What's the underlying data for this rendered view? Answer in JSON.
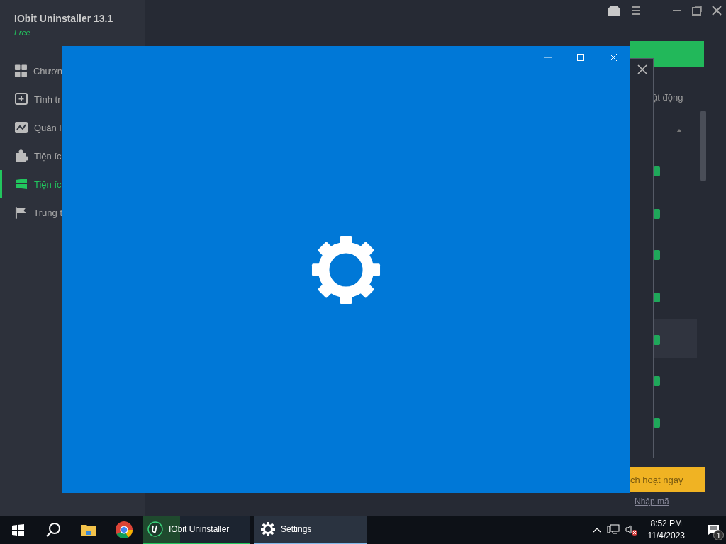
{
  "background_app": {
    "title": "IObit Uninstaller 13.1",
    "edition": "Free",
    "sidebar": [
      {
        "label": "Chươn",
        "selected": false
      },
      {
        "label": "Tình tr",
        "selected": false
      },
      {
        "label": "Quản l",
        "selected": false
      },
      {
        "label": "Tiện íc",
        "selected": false
      },
      {
        "label": "Tiện íc",
        "selected": true
      },
      {
        "label": "Trung t",
        "selected": false
      }
    ],
    "section_label": "ật động",
    "activate_button": "ch hoạt ngay",
    "link": "Nhập mã"
  },
  "taskbar": {
    "apps": [
      {
        "label": "IObit Uninstaller",
        "kind": "iobit",
        "selected": false
      },
      {
        "label": "Settings",
        "kind": "settings",
        "selected": true
      }
    ],
    "clock": {
      "time": "8:52 PM",
      "date": "11/4/2023"
    },
    "notification_count": "1"
  }
}
